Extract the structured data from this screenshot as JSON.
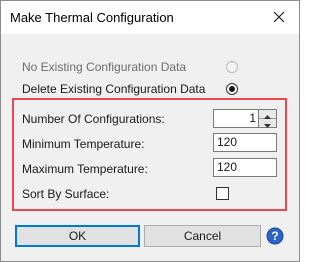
{
  "window": {
    "title": "Make Thermal Configuration",
    "close_icon": "close-icon"
  },
  "options": {
    "no_existing_label": "No Existing Configuration Data",
    "delete_existing_label": "Delete Existing Configuration Data",
    "selected": "delete_existing",
    "no_existing_enabled": false
  },
  "fields": {
    "num_configurations": {
      "label": "Number Of Configurations:",
      "value": "1"
    },
    "min_temperature": {
      "label": "Minimum Temperature:",
      "value": "120"
    },
    "max_temperature": {
      "label": "Maximum Temperature:",
      "value": "120"
    },
    "sort_by_surface": {
      "label": "Sort By Surface:",
      "checked": false
    }
  },
  "buttons": {
    "ok_label": "OK",
    "cancel_label": "Cancel",
    "help_icon": "help-icon"
  },
  "colors": {
    "highlight": "#e8484f",
    "accent": "#0078d7"
  }
}
